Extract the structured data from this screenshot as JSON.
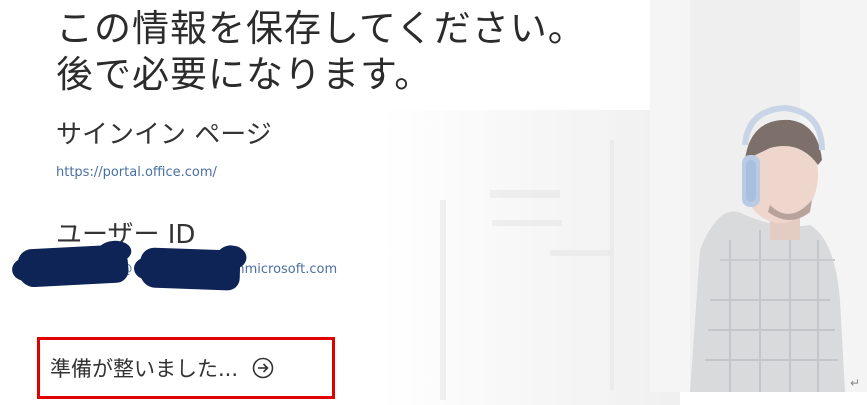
{
  "heading": {
    "line1": "この情報を保存してください。",
    "line2": "後で必要になります。"
  },
  "signin": {
    "title": "サインイン ページ",
    "url": "https://portal.office.com/"
  },
  "userid": {
    "title": "ユーザー ID",
    "value": "user@contoso.onmicrosoft.com",
    "visible_suffix": "r@",
    "visible_domain": "nmicrosoft.com"
  },
  "ready_button": {
    "label": "準備が整いました...",
    "icon": "circle-arrow-right-icon"
  },
  "photo": {
    "description_icon": "person-with-headphones-photo"
  },
  "misc": {
    "return_mark": "↵"
  },
  "colors": {
    "heading_text": "#2b2b2b",
    "link": "#4a6fa5",
    "redaction": "#0e2356",
    "highlight_border": "#e00000"
  }
}
